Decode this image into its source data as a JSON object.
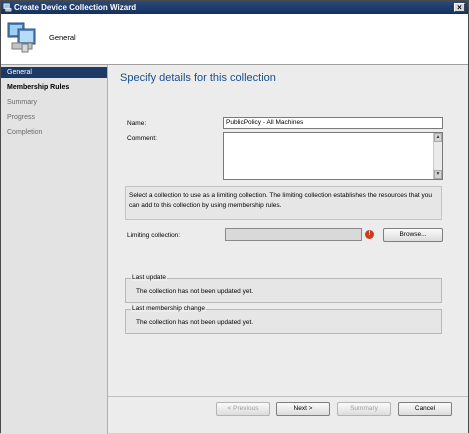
{
  "window": {
    "title": "Create Device Collection Wizard",
    "close_glyph": "×"
  },
  "header": {
    "title": "General",
    "icon": "computers-icon"
  },
  "nav": {
    "items": [
      {
        "label": "General",
        "state": "selected"
      },
      {
        "label": "Membership Rules",
        "state": "bold"
      },
      {
        "label": "Summary",
        "state": "normal"
      },
      {
        "label": "Progress",
        "state": "normal"
      },
      {
        "label": "Completion",
        "state": "normal"
      }
    ]
  },
  "content": {
    "heading": "Specify details for this collection",
    "name_label": "Name:",
    "name_value": "PublicPolicy - All Machines",
    "comment_label": "Comment:",
    "comment_value": "",
    "info_text": "Select a collection to use as a limiting collection. The limiting collection establishes the resources that you can add to this collection by using membership rules.",
    "limiting_label": "Limiting collection:",
    "limiting_value": "",
    "warning_glyph": "!",
    "browse_label": "Browse...",
    "last_update": {
      "title": "Last update",
      "text": "The collection has not been updated yet."
    },
    "last_membership": {
      "title": "Last membership change",
      "text": "The collection has not been updated yet."
    }
  },
  "footer": {
    "previous_label": "< Previous",
    "next_label": "Next >",
    "summary_label": "Summary",
    "cancel_label": "Cancel"
  },
  "colors": {
    "title_bar": "#1d3a66",
    "heading": "#1a4f8a",
    "selected_nav": "#1d3a66",
    "warning": "#cc3d1f"
  }
}
